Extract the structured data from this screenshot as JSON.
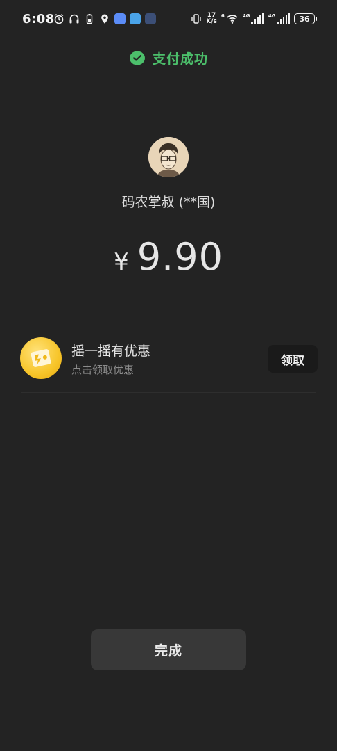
{
  "status_bar": {
    "time": "6:08",
    "net_speed_value": "17",
    "net_speed_unit": "K/s",
    "signal1_tag": "4G",
    "signal2_tag": "4G",
    "wifi_tag": "6",
    "battery": "36"
  },
  "header": {
    "success_text": "支付成功",
    "success_color": "#4cbf6b"
  },
  "merchant": {
    "name": "码农掌叔 (**国)"
  },
  "payment": {
    "currency": "¥",
    "amount": "9.90"
  },
  "promo": {
    "title": "摇一摇有优惠",
    "subtitle": "点击领取优惠",
    "button": "领取",
    "icon": "shake-coupon-icon"
  },
  "footer": {
    "done_button": "完成"
  }
}
